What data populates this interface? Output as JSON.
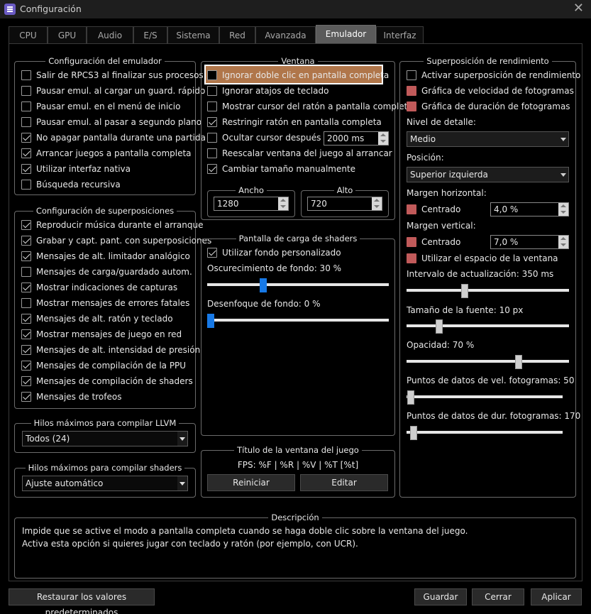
{
  "window": {
    "title": "Configuración",
    "close_glyph": "✕"
  },
  "tabs": [
    "CPU",
    "GPU",
    "Audio",
    "E/S",
    "Sistema",
    "Red",
    "Avanzada",
    "Emulador",
    "Interfaz"
  ],
  "emu_config": {
    "title": "Configuración del emulador",
    "items": [
      {
        "label": "Salir de RPCS3 al finalizar sus procesos",
        "checked": false
      },
      {
        "label": "Pausar emul. al cargar un guard. rápido",
        "checked": false
      },
      {
        "label": "Pausar emul. en el menú de inicio",
        "checked": false
      },
      {
        "label": "Pausar emul. al pasar a segundo plano",
        "checked": false
      },
      {
        "label": "No apagar pantalla durante una partida",
        "checked": true
      },
      {
        "label": "Arrancar juegos a pantalla completa",
        "checked": true
      },
      {
        "label": "Utilizar interfaz nativa",
        "checked": true
      },
      {
        "label": "Búsqueda recursiva",
        "checked": false
      }
    ]
  },
  "overlay_config": {
    "title": "Configuración de superposiciones",
    "items": [
      {
        "label": "Reproducir música durante el arranque",
        "checked": true
      },
      {
        "label": "Grabar y capt. pant. con superposiciones",
        "checked": true
      },
      {
        "label": "Mensajes de alt. limitador analógico",
        "checked": true
      },
      {
        "label": "Mensajes de carga/guardado autom.",
        "checked": false
      },
      {
        "label": "Mostrar indicaciones de capturas",
        "checked": true
      },
      {
        "label": "Mostrar mensajes de errores fatales",
        "checked": false
      },
      {
        "label": "Mensajes de alt. ratón y teclado",
        "checked": true
      },
      {
        "label": "Mostrar mensajes de juego en red",
        "checked": true
      },
      {
        "label": "Mensajes de alt. intensidad de presión",
        "checked": true
      },
      {
        "label": "Mensajes de compilación de la PPU",
        "checked": true
      },
      {
        "label": "Mensajes de compilación de shaders",
        "checked": true
      },
      {
        "label": "Mensajes de trofeos",
        "checked": true
      }
    ]
  },
  "llvm_threads": {
    "title": "Hilos máximos para compilar LLVM",
    "value": "Todos (24)"
  },
  "shader_threads": {
    "title": "Hilos máximos para compilar shaders",
    "value": "Ajuste automático"
  },
  "window_group": {
    "title": "Ventana",
    "items": [
      {
        "label": "Ignorar doble clic en pantalla completa",
        "checked": false
      },
      {
        "label": "Ignorar atajos de teclado",
        "checked": false
      },
      {
        "label": "Mostrar cursor del ratón a pantalla completa",
        "checked": false
      },
      {
        "label": "Restringir ratón en pantalla completa",
        "checked": true
      },
      {
        "label": "Ocultar cursor después de",
        "checked": false
      },
      {
        "label": "Reescalar ventana del juego al arrancar",
        "checked": false
      },
      {
        "label": "Cambiar tamaño manualmente",
        "checked": true
      }
    ],
    "hide_cursor_ms": "2000 ms",
    "width": {
      "title": "Ancho",
      "value": "1280"
    },
    "height": {
      "title": "Alto",
      "value": "720"
    }
  },
  "shader_loading": {
    "title": "Pantalla de carga de shaders",
    "use_custom_bg": {
      "label": "Utilizar fondo personalizado",
      "checked": true
    },
    "darkening_label": "Oscurecimiento de fondo: 30 %",
    "darkening_value": 30,
    "blur_label": "Desenfoque de fondo: 0 %",
    "blur_value": 0
  },
  "game_window_title": {
    "title": "Título de la ventana del juego",
    "format": "FPS: %F | %R | %V | %T [%t]",
    "reset": "Reiniciar",
    "edit": "Editar"
  },
  "perf_overlay": {
    "title": "Superposición de rendimiento",
    "enable": {
      "label": "Activar superposición de rendimiento",
      "checked": false
    },
    "framerate_graph": {
      "label": "Gráfica de velocidad de fotogramas",
      "checked": false
    },
    "frametime_graph": {
      "label": "Gráfica de duración de fotogramas",
      "checked": false
    },
    "detail_label": "Nivel de detalle:",
    "detail_value": "Medio",
    "position_label": "Posición:",
    "position_value": "Superior izquierda",
    "margin_h_label": "Margen horizontal:",
    "margin_h_center": {
      "label": "Centrado",
      "checked": false
    },
    "margin_h_value": "4,0 %",
    "margin_v_label": "Margen vertical:",
    "margin_v_center": {
      "label": "Centrado",
      "checked": false
    },
    "margin_v_value": "7,0 %",
    "use_window_space": {
      "label": "Utilizar el espacio de la ventana",
      "checked": false
    },
    "update_interval_label": "Intervalo de actualización: 350 ms",
    "update_interval_value": 350,
    "font_size_label": "Tamaño de la fuente: 10 px",
    "font_size_value": 10,
    "opacity_label": "Opacidad: 70 %",
    "opacity_value": 70,
    "fps_points_label": "Puntos de datos de vel. fotogramas: 50",
    "fps_points_value": 50,
    "frametime_points_label": "Puntos de datos de dur. fotogramas: 170",
    "frametime_points_value": 170
  },
  "description": {
    "title": "Descripción",
    "lines": [
      "Impide que se active el modo a pantalla completa cuando se haga doble clic sobre la ventana del juego.",
      "Activa esta opción si quieres jugar con teclado y ratón (por ejemplo, con UCR)."
    ]
  },
  "footer": {
    "restore": "Restaurar los valores predeterminados",
    "save": "Guardar",
    "close": "Cerrar",
    "apply": "Aplicar"
  },
  "colors": {
    "highlight": "#b0764a",
    "red_checkbox": "#c15a5a",
    "slider_blue": "#1779e6",
    "tab_active": "#5b5b5b"
  }
}
